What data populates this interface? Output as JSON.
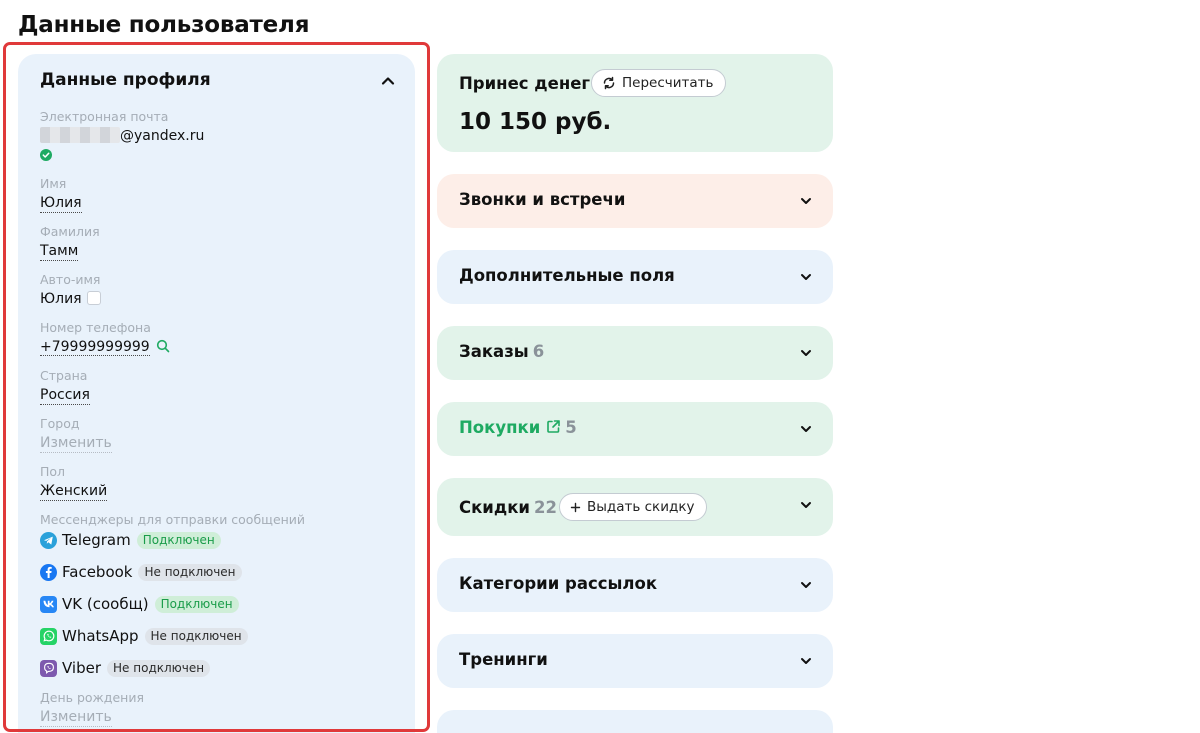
{
  "page": {
    "title": "Данные пользователя"
  },
  "profile": {
    "title": "Данные профиля",
    "email": {
      "label": "Электронная почта",
      "value": "@yandex.ru"
    },
    "first_name": {
      "label": "Имя",
      "value": "Юлия"
    },
    "last_name": {
      "label": "Фамилия",
      "value": "Тамм"
    },
    "auto_name": {
      "label": "Авто-имя",
      "value": "Юлия"
    },
    "phone": {
      "label": "Номер телефона",
      "value": "+79999999999"
    },
    "country": {
      "label": "Страна",
      "value": "Россия"
    },
    "city": {
      "label": "Город",
      "value": "Изменить"
    },
    "gender": {
      "label": "Пол",
      "value": "Женский"
    },
    "messengers": {
      "label": "Мессенджеры для отправки сообщений",
      "items": [
        {
          "name": "Telegram",
          "status": "Подключен",
          "connected": true,
          "icon": "telegram-icon",
          "color": "#2aa1da"
        },
        {
          "name": "Facebook",
          "status": "Не подключен",
          "connected": false,
          "icon": "facebook-icon",
          "color": "#1877f2"
        },
        {
          "name": "VK (сообщ)",
          "status": "Подключен",
          "connected": true,
          "icon": "vk-icon",
          "color": "#2787f5"
        },
        {
          "name": "WhatsApp",
          "status": "Не подключен",
          "connected": false,
          "icon": "whatsapp-icon",
          "color": "#25d366"
        },
        {
          "name": "Viber",
          "status": "Не подключен",
          "connected": false,
          "icon": "viber-icon",
          "color": "#7d59ae"
        }
      ]
    },
    "birthday": {
      "label": "День рождения",
      "value": "Изменить"
    }
  },
  "money_card": {
    "title": "Принес денег",
    "recalc_label": "Пересчитать",
    "amount": "10 150 руб.",
    "bg": "#e2f3ea"
  },
  "sections": [
    {
      "title": "Звонки и встречи",
      "count": "",
      "bg": "#fdeee8"
    },
    {
      "title": "Дополнительные поля",
      "count": "",
      "bg": "#e9f2fb"
    },
    {
      "title": "Заказы",
      "count": "6",
      "bg": "#e2f3ea"
    },
    {
      "title": "Покупки",
      "count": "5",
      "bg": "#e2f3ea",
      "title_color": "#1eaa62"
    },
    {
      "title": "Скидки",
      "count": "22",
      "bg": "#e2f3ea",
      "action_label": "Выдать скидку"
    },
    {
      "title": "Категории рассылок",
      "count": "",
      "bg": "#e9f2fb"
    },
    {
      "title": "Тренинги",
      "count": "",
      "bg": "#e9f2fb"
    }
  ]
}
